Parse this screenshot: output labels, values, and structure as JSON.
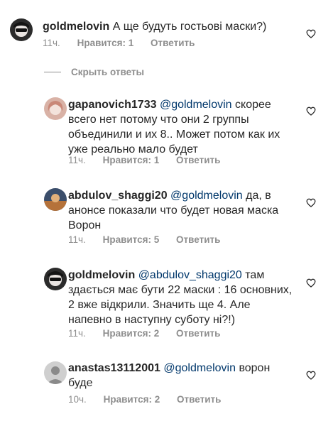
{
  "comments": [
    {
      "username": "goldmelovin",
      "mention": "",
      "text": "А ще будуть гостьові маски?)",
      "time": "11ч.",
      "likes": "Нравится: 1",
      "reply": "Ответить",
      "icon": "heart-outline-icon"
    },
    {
      "username": "gapanovich1733",
      "mention": "@goldmelovin",
      "text": "скорее всего нет потому что они 2 группы объединили и их 8.. Может потом как их уже реально мало будет",
      "time": "11ч.",
      "likes": "Нравится: 1",
      "reply": "Ответить",
      "icon": "heart-outline-icon"
    },
    {
      "username": "abdulov_shaggi20",
      "mention": "@goldmelovin",
      "text": "да, в анонсе показали что будет новая маска Ворон",
      "time": "11ч.",
      "likes": "Нравится: 5",
      "reply": "Ответить",
      "icon": "heart-outline-icon"
    },
    {
      "username": "goldmelovin",
      "mention": "@abdulov_shaggi20",
      "text": "там здається має бути 22 маски : 16 основних, 2 вже відкрили. Значить ще 4. Але напевно в наступну суботу ні?!)",
      "time": "11ч.",
      "likes": "Нравится: 2",
      "reply": "Ответить",
      "icon": "heart-outline-icon"
    },
    {
      "username": "anastas13112001",
      "mention": "@goldmelovin",
      "text": "ворон буде",
      "time": "10ч.",
      "likes": "Нравится: 2",
      "reply": "Ответить",
      "icon": "heart-outline-icon"
    }
  ],
  "hide_replies_label": "Скрыть ответы",
  "colors": {
    "text": "#262626",
    "mention": "#00376b",
    "secondary": "#8e8e8e"
  }
}
